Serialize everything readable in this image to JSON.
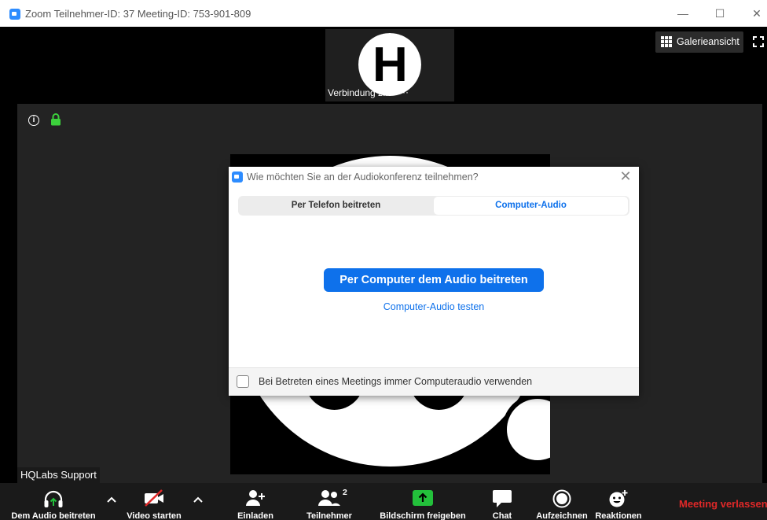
{
  "window": {
    "title": "Zoom Teilnehmer-ID: 37   Meeting-ID: 753-901-809",
    "minimize": "—",
    "maximize": "☐",
    "close": "✕"
  },
  "stage": {
    "thumbnail_initial": "H",
    "thumbnail_label": "Verbindung z...",
    "thumbnail_more": "···",
    "gallery_label": "Galerieansicht",
    "info_glyph": "i",
    "participant_name": "HQLabs Support"
  },
  "dialog": {
    "title": "Wie möchten Sie an der Audiokonferenz teilnehmen?",
    "close": "✕",
    "tabs": [
      {
        "label": "Per Telefon beitreten"
      },
      {
        "label": "Computer-Audio"
      }
    ],
    "join_button": "Per Computer dem Audio beitreten",
    "test_link": "Computer-Audio testen",
    "checkbox_label": "Bei Betreten eines Meetings immer Computeraudio verwenden"
  },
  "toolbar": {
    "audio": "Dem Audio beitreten",
    "video": "Video starten",
    "invite": "Einladen",
    "participants": "Teilnehmer",
    "participants_count": "2",
    "share": "Bildschirm freigeben",
    "chat": "Chat",
    "record": "Aufzeichnen",
    "reactions": "Reaktionen",
    "leave": "Meeting verlassen"
  },
  "colors": {
    "accent": "#0E71EB",
    "share_green": "#23C03B",
    "leave_red": "#E02828",
    "lock_green": "#3CD13C"
  }
}
